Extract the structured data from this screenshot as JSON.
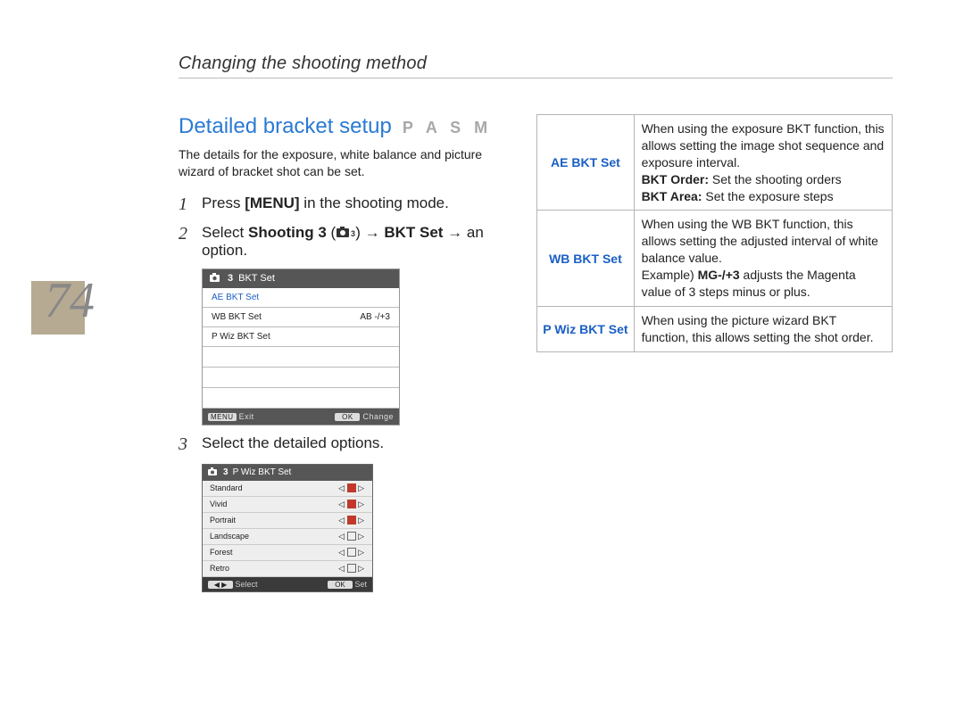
{
  "header": {
    "section": "Changing the shooting method"
  },
  "page_number": "74",
  "title": {
    "text": "Detailed bracket setup",
    "modes": "P A S M"
  },
  "intro": "The details for the exposure, white balance and picture wizard of bracket shot can be set.",
  "steps": {
    "s1_num": "1",
    "s1_a": "Press ",
    "s1_b": "[MENU]",
    "s1_c": " in the shooting mode.",
    "s2_num": "2",
    "s2_a": "Select ",
    "s2_b": "Shooting 3",
    "s2_c": " (",
    "s2_d": ") ",
    "s2_e": "→",
    "s2_f": " BKT Set ",
    "s2_g": "→",
    "s2_h": " an option.",
    "s3_num": "3",
    "s3_text": "Select the detailed options."
  },
  "screenshot1": {
    "title_badge": "3",
    "title": "BKT Set",
    "rows": [
      {
        "label": "AE BKT Set",
        "value": "",
        "selected": true
      },
      {
        "label": "WB BKT Set",
        "value": "AB -/+3"
      },
      {
        "label": "P Wiz BKT Set",
        "value": ""
      }
    ],
    "footer": {
      "left_key": "MENU",
      "left": "Exit",
      "right_key": "OK",
      "right": "Change"
    }
  },
  "screenshot2": {
    "title_badge": "3",
    "title": "P Wiz BKT Set",
    "rows": [
      {
        "label": "Standard",
        "red": true
      },
      {
        "label": "Vivid",
        "red": true
      },
      {
        "label": "Portrait",
        "red": true
      },
      {
        "label": "Landscape",
        "red": false
      },
      {
        "label": "Forest",
        "red": false
      },
      {
        "label": "Retro",
        "red": false
      }
    ],
    "footer": {
      "left_key": "◀ ▶",
      "left": "Select",
      "right_key": "OK",
      "right": "Set"
    }
  },
  "options_table": [
    {
      "label": "AE BKT Set",
      "desc_pre": "When using the exposure BKT function, this allows setting the image shot sequence and exposure interval.",
      "l1b": "BKT Order:",
      "l1": " Set the shooting orders",
      "l2b": "BKT Area:",
      "l2": " Set the exposure steps"
    },
    {
      "label": "WB BKT Set",
      "desc_pre": "When using the WB  BKT function, this allows setting the adjusted interval of white balance value.",
      "eg1": "Example) ",
      "eg1b": "MG-/+3",
      "eg1c": " adjusts the Magenta value of 3 steps minus or plus."
    },
    {
      "label": "P Wiz BKT Set",
      "desc_pre": "When using the picture wizard BKT function, this allows setting the shot order."
    }
  ]
}
